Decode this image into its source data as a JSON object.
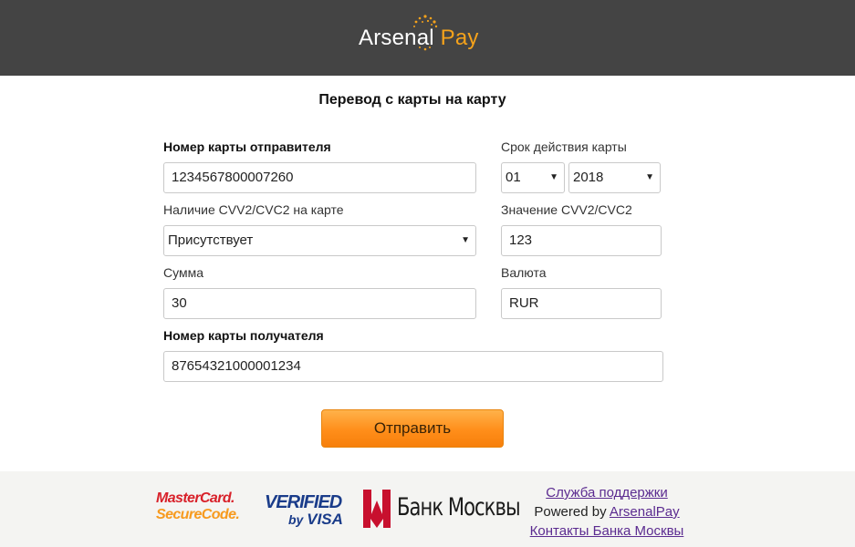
{
  "header": {
    "logo_part1": "Arsenal",
    "logo_part2": "Pay"
  },
  "form": {
    "title": "Перевод с карты на карту",
    "sender_card": {
      "label": "Номер карты отправителя",
      "value": "1234567800007260"
    },
    "expiry": {
      "label": "Срок действия карты",
      "month": "01",
      "year": "2018"
    },
    "cvv_presence": {
      "label": "Наличие CVV2/CVC2 на карте",
      "value": "Присутствует"
    },
    "cvv_value": {
      "label": "Значение CVV2/CVC2",
      "value": "123"
    },
    "amount": {
      "label": "Сумма",
      "value": "30"
    },
    "currency": {
      "label": "Валюта",
      "value": "RUR"
    },
    "receiver_card": {
      "label": "Номер карты получателя",
      "value": "87654321000001234"
    },
    "submit_label": "Отправить"
  },
  "footer": {
    "mastercard_line1": "MasterCard.",
    "mastercard_line2": "SecureCode.",
    "visa_line1": "VERIFIED",
    "visa_by": "by",
    "visa_line2": "VISA",
    "bank_name": "Банк Москвы",
    "support_link": "Служба поддержки",
    "powered_by": "Powered by",
    "powered_link": "ArsenalPay",
    "bank_contacts_link": "Контакты Банка Москвы"
  },
  "colors": {
    "header_bg": "#444444",
    "accent_orange": "#f5a21b",
    "button_orange": "#ff8e1a",
    "link_purple": "#5b2b90"
  }
}
